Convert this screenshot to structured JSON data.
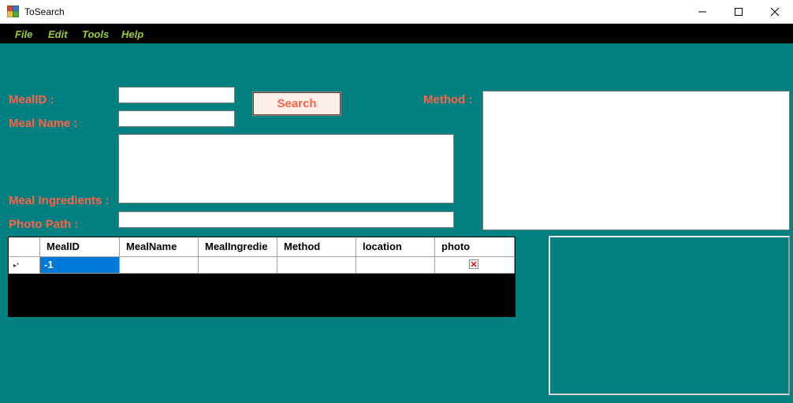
{
  "window": {
    "title": "ToSearch"
  },
  "menu": {
    "items": [
      "File",
      "Edit",
      "Tools",
      "Help"
    ]
  },
  "form": {
    "meal_id_label": "MealID :",
    "meal_name_label": "Meal Name :",
    "meal_ingredients_label": "Meal Ingredients :",
    "photo_path_label": "Photo Path :",
    "method_label": "Method :",
    "search_button": "Search",
    "meal_id_value": "",
    "meal_name_value": "",
    "meal_ingredients_value": "",
    "photo_path_value": "",
    "method_value": ""
  },
  "grid": {
    "columns": [
      "MealID",
      "MealName",
      "MealIngredie",
      "Method",
      "location",
      "photo"
    ],
    "rows": [
      {
        "selector": "▸*",
        "MealID": "-1",
        "MealName": "",
        "MealIngredients": "",
        "Method": "",
        "location": ""
      }
    ]
  },
  "colors": {
    "background": "#008080",
    "label": "#ff6347",
    "menu_text": "#9acd32",
    "selection": "#0078d7"
  }
}
